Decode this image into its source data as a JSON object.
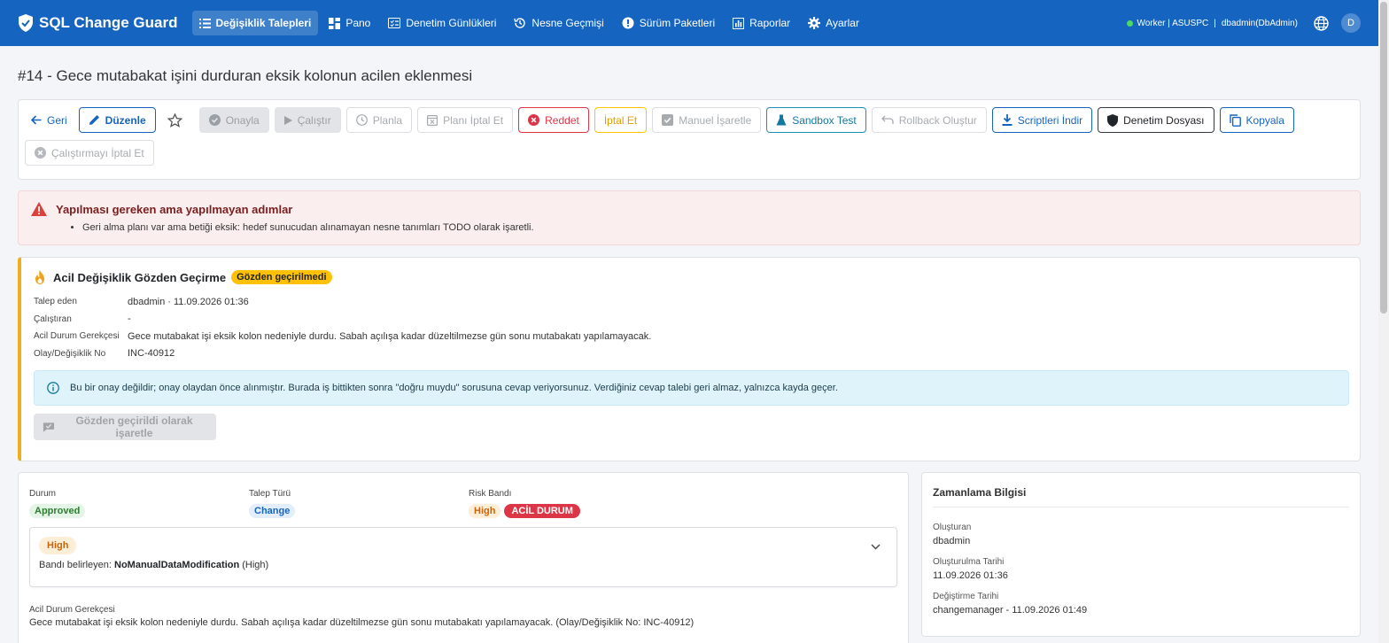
{
  "app": {
    "brand": "SQL Change Guard",
    "nav": [
      {
        "label": "Değişiklik Talepleri",
        "icon": "list-icon",
        "active": true
      },
      {
        "label": "Pano",
        "icon": "dashboard-icon"
      },
      {
        "label": "Denetim Günlükleri",
        "icon": "checklist-icon"
      },
      {
        "label": "Nesne Geçmişi",
        "icon": "history-icon"
      },
      {
        "label": "Sürüm Paketleri",
        "icon": "package-icon"
      },
      {
        "label": "Raporlar",
        "icon": "chart-icon"
      },
      {
        "label": "Ayarlar",
        "icon": "gear-icon"
      }
    ],
    "status": "Worker | ASUSPC",
    "separator": "|",
    "user": "dbadmin(DbAdmin)",
    "avatar_letter": "D"
  },
  "page": {
    "title": "#14 - Gece mutabakat işini durduran eksik kolonun acilen eklenmesi"
  },
  "toolbar": {
    "back": "Geri",
    "edit": "Düzenle",
    "approve": "Onayla",
    "run": "Çalıştır",
    "schedule": "Planla",
    "cancel_plan": "Planı İptal Et",
    "reject": "Reddet",
    "cancel": "İptal Et",
    "manual_mark": "Manuel İşaretle",
    "sandbox": "Sandbox Test",
    "rollback": "Rollback Oluştur",
    "download": "Scriptleri İndir",
    "audit": "Denetim Dosyası",
    "copy": "Kopyala",
    "cancel_run": "Çalıştırmayı İptal Et"
  },
  "alert": {
    "title": "Yapılması gereken ama yapılmayan adımlar",
    "items": [
      "Geri alma planı var ama betiği eksik: hedef sunucudan alınamayan nesne tanımları TODO olarak işaretli."
    ]
  },
  "review": {
    "title": "Acil Değişiklik Gözden Geçirme",
    "badge": "Gözden geçirilmedi",
    "fields": [
      {
        "label": "Talep eden",
        "value": "dbadmin · 11.09.2026 01:36"
      },
      {
        "label": "Çalıştıran",
        "value": "-"
      },
      {
        "label": "Acil Durum Gerekçesi",
        "value": "Gece mutabakat işi eksik kolon nedeniyle durdu. Sabah açılışa kadar düzeltilmezse gün sonu mutabakatı yapılamayacak."
      },
      {
        "label": "Olay/Değişiklik No",
        "value": "INC-40912"
      }
    ],
    "info": "Bu bir onay değildir; onay olaydan önce alınmıştır. Burada iş bittikten sonra \"doğru muydu\" sorusuna cevap veriyorsunuz. Verdiğiniz cevap talebi geri almaz, yalnızca kayda geçer.",
    "mark_button": "Gözden geçirildi olarak işaretle"
  },
  "details": {
    "status_label": "Durum",
    "status": "Approved",
    "type_label": "Talep Türü",
    "type": "Change",
    "risk_label": "Risk Bandı",
    "risk": "High",
    "emergency": "ACİL DURUM",
    "risk_box_band": "High",
    "risk_box_prefix": "Bandı belirleyen:",
    "risk_box_rule": "NoManualDataModification",
    "risk_box_suffix": "(High)",
    "reason_label": "Acil Durum Gerekçesi",
    "reason": "Gece mutabakat işi eksik kolon nedeniyle durdu. Sabah açılışa kadar düzeltilmezse gün sonu mutabakatı yapılamayacak. (Olay/Değişiklik No: INC-40912)"
  },
  "timing": {
    "title": "Zamanlama Bilgisi",
    "items": [
      {
        "label": "Oluşturan",
        "value": "dbadmin"
      },
      {
        "label": "Oluşturulma Tarihi",
        "value": "11.09.2026 01:36"
      },
      {
        "label": "Değiştirme Tarihi",
        "value": "changemanager - 11.09.2026 01:49"
      }
    ]
  },
  "colors": {
    "primary": "#1565c0",
    "danger": "#dc3545",
    "warning": "#ffc107",
    "success": "#2e7d32"
  }
}
